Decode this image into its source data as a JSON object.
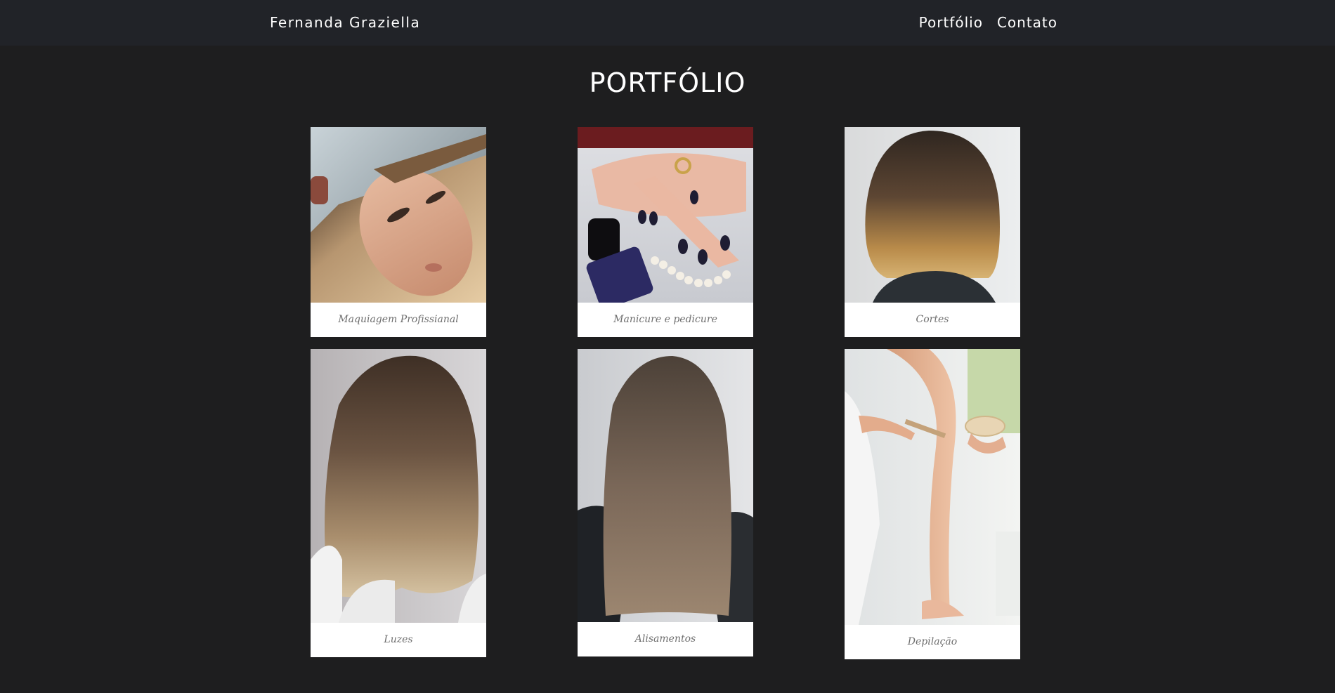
{
  "navbar": {
    "brand": "Fernanda Graziella",
    "links": [
      {
        "label": "Portfólio"
      },
      {
        "label": "Contato"
      }
    ]
  },
  "main": {
    "title": "PORTFÓLIO"
  },
  "portfolio": {
    "items": [
      {
        "caption": "Maquiagem Profissianal",
        "image": "makeup-photo"
      },
      {
        "caption": "Manicure e pedicure",
        "image": "manicure-photo"
      },
      {
        "caption": "Cortes",
        "image": "haircut-photo"
      },
      {
        "caption": "Luzes",
        "image": "highlights-photo"
      },
      {
        "caption": "Alisamentos",
        "image": "straightening-photo"
      },
      {
        "caption": "Depilação",
        "image": "waxing-photo"
      }
    ]
  },
  "colors": {
    "background": "#1e1e1f",
    "navbar": "#212328",
    "text": "#ffffff",
    "caption": "#6e6e6e"
  }
}
